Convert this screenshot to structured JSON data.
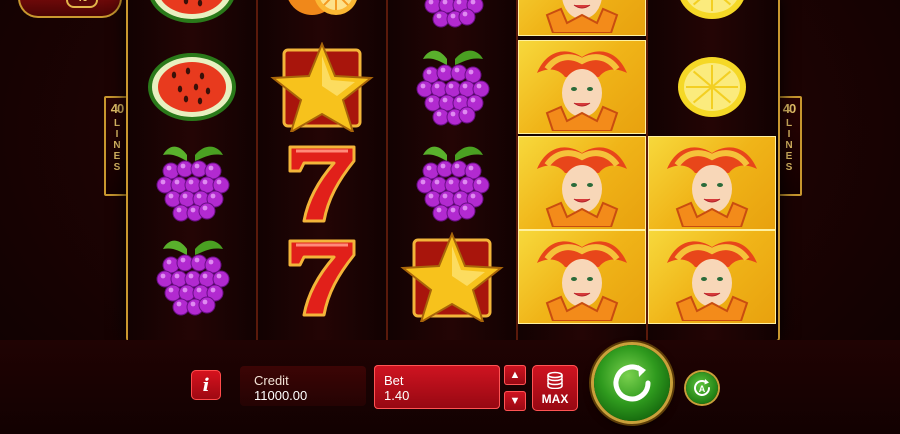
{
  "logo": {
    "badge": "40"
  },
  "lines_indicator": {
    "left_number": "40",
    "left_word": "LINES",
    "right_number": "40",
    "right_word": "LINES"
  },
  "reels": [
    [
      "watermelon",
      "watermelon",
      "grapes",
      "grapes"
    ],
    [
      "orange",
      "star",
      "seven",
      "seven"
    ],
    [
      "grapes",
      "grapes",
      "grapes",
      "star"
    ],
    [
      "joker",
      "joker",
      "joker",
      "joker"
    ],
    [
      "lemon",
      "lemon",
      "joker",
      "joker"
    ]
  ],
  "controls": {
    "info_label": "i",
    "credit_label": "Credit",
    "credit_value": "11000.00",
    "bet_label": "Bet",
    "bet_value": "1.40",
    "bet_up": "▲",
    "bet_down": "▼",
    "max_label": "MAX",
    "auto_label": "A"
  },
  "icons": {
    "info": "info-icon",
    "spin": "spin-arrow-icon",
    "autoplay": "autoplay-icon",
    "coins": "coin-stack-icon"
  },
  "colors": {
    "accent_red": "#d01421",
    "spin_green": "#2f9a1e",
    "gold_frame": "#c9982f"
  }
}
